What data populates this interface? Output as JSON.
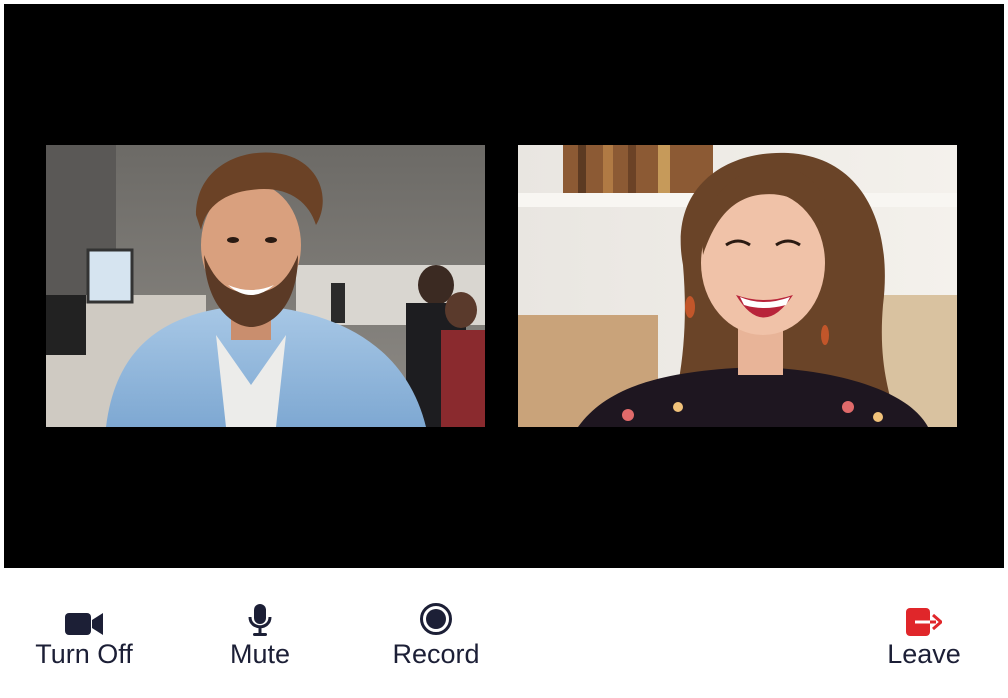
{
  "controls": {
    "video": {
      "label": "Turn Off",
      "icon": "video-camera-icon"
    },
    "mute": {
      "label": "Mute",
      "icon": "microphone-icon"
    },
    "record": {
      "label": "Record",
      "icon": "record-icon"
    },
    "leave": {
      "label": "Leave",
      "icon": "leave-icon"
    }
  },
  "colors": {
    "stage_background": "#000000",
    "icon_dark": "#1c1f36",
    "leave_red": "#e0262a"
  }
}
